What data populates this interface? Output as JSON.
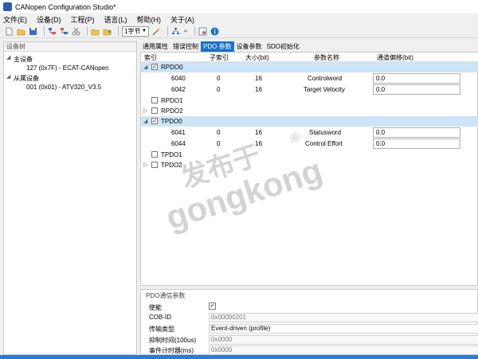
{
  "window": {
    "title": "CANopen Configuration Studio*"
  },
  "menu": [
    "文件(E)",
    "设备(D)",
    "工程(P)",
    "语言(L)",
    "帮助(H)",
    "关于(A)"
  ],
  "toolbar": {
    "byte_select": "1字节"
  },
  "device_tree": {
    "header": "设备树",
    "master_label": "主设备",
    "master_item": "127 (0x7F)  -  ECAT-CANopen",
    "slave_label": "从属设备",
    "slave_item": "001 (0x01)  -  ATV320_V3.5"
  },
  "tabs": [
    "通用属性",
    "错误控制",
    "PDO 参数",
    "设备参数",
    "SDO初始化"
  ],
  "columns": {
    "index": "索引",
    "subindex": "子索引",
    "size": "大小(bit)",
    "name": "参数名称",
    "offset": "通道偏移(bit)"
  },
  "rows": [
    {
      "label": "RPDO0",
      "checked": "✓",
      "selected": true
    },
    {
      "index": "6040",
      "subindex": "0",
      "size": "16",
      "name": "Controlword",
      "offset": "0.0"
    },
    {
      "index": "6042",
      "subindex": "0",
      "size": "16",
      "name": "Target Velocity",
      "offset": "0.0"
    },
    {
      "label": "RPDO1",
      "checked": ""
    },
    {
      "label": "RPDO2",
      "checked": ""
    },
    {
      "label": "TPDO0",
      "checked": "✓",
      "selected": true
    },
    {
      "index": "6041",
      "subindex": "0",
      "size": "16",
      "name": "Statusword",
      "offset": "0.0"
    },
    {
      "index": "6044",
      "subindex": "0",
      "size": "16",
      "name": "Control Effort",
      "offset": "0.0"
    },
    {
      "label": "TPDO1",
      "checked": ""
    },
    {
      "label": "TPDO2",
      "checked": ""
    }
  ],
  "comm": {
    "title": "PDO通信参数",
    "enable_label": "使能",
    "enable_check": "✓",
    "cobid_label": "COB-ID",
    "cobid_value": "0x00000201",
    "trans_label": "传输类型",
    "trans_value": "Event-driven (profile)",
    "inhibit_label": "抑制时间(100us)",
    "inhibit_value": "0x0000",
    "event_label": "事件计时器(ms)",
    "event_value": "0x0000"
  },
  "watermark": {
    "line1": "发布于",
    "line2": "gongkong",
    "mark": "®"
  },
  "colors": {
    "accent": "#1a73c8",
    "selected_row": "#cde4f7",
    "statusbar": "#2b7bd8"
  }
}
